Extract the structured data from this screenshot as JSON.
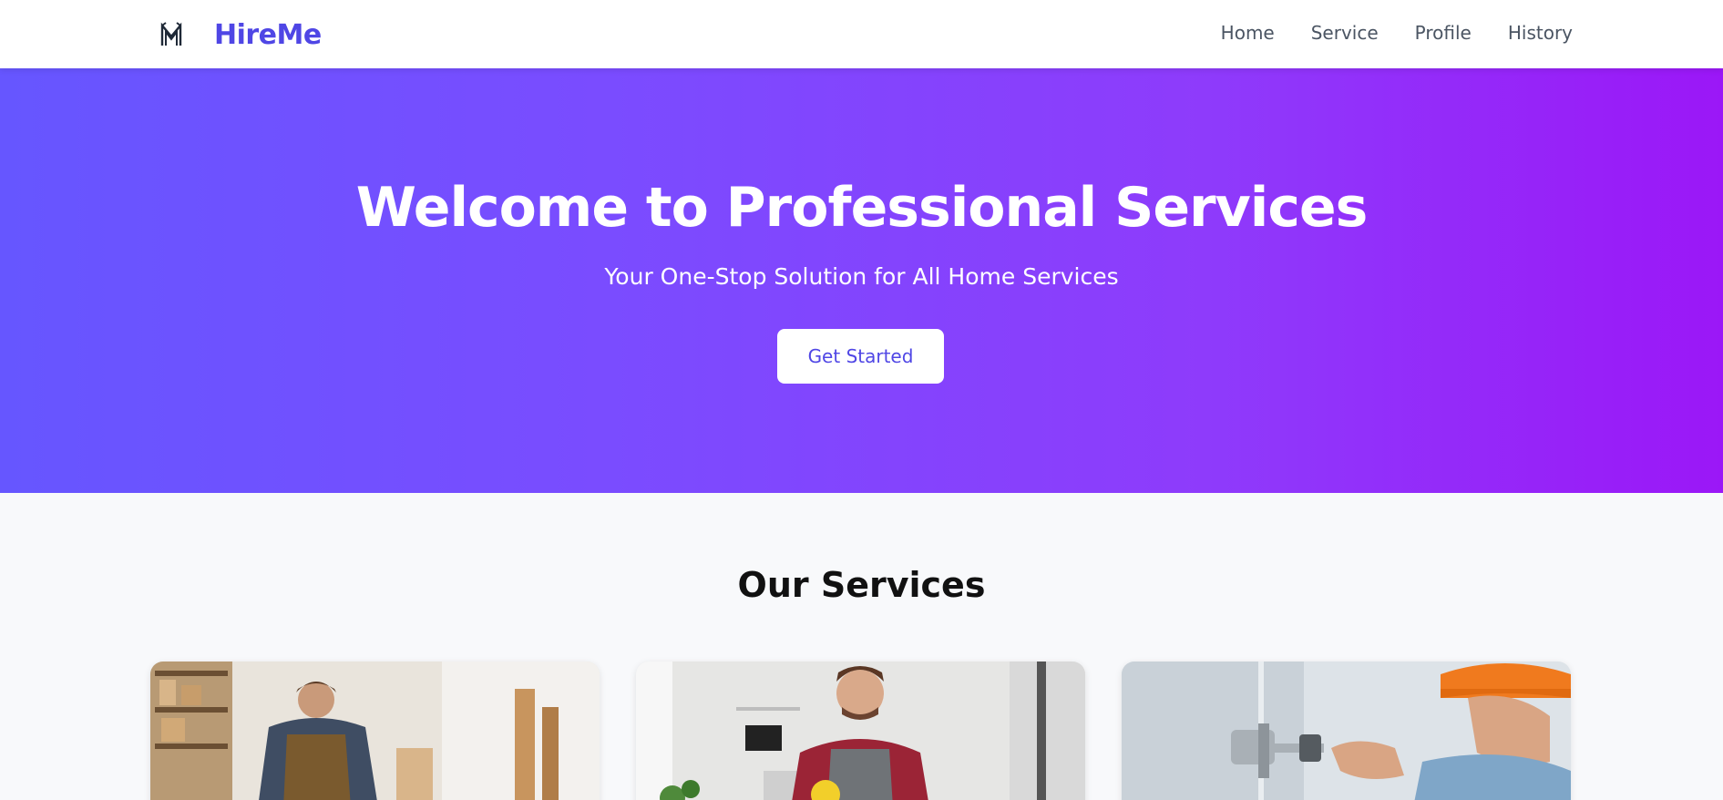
{
  "brand": {
    "name": "HireMe",
    "logo_icon": "monogram-logo-icon",
    "color": "#4f46e5"
  },
  "nav": {
    "items": [
      {
        "label": "Home"
      },
      {
        "label": "Service"
      },
      {
        "label": "Profile"
      },
      {
        "label": "History"
      }
    ]
  },
  "hero": {
    "title": "Welcome to Professional Services",
    "subtitle": "Your One-Stop Solution for All Home Services",
    "cta_label": "Get Started",
    "gradient_start": "#6656ff",
    "gradient_end": "#9b17f7"
  },
  "services": {
    "title": "Our Services",
    "cards": [
      {
        "image": "carpenter-photo"
      },
      {
        "image": "cleaner-photo"
      },
      {
        "image": "plumber-photo"
      }
    ]
  }
}
